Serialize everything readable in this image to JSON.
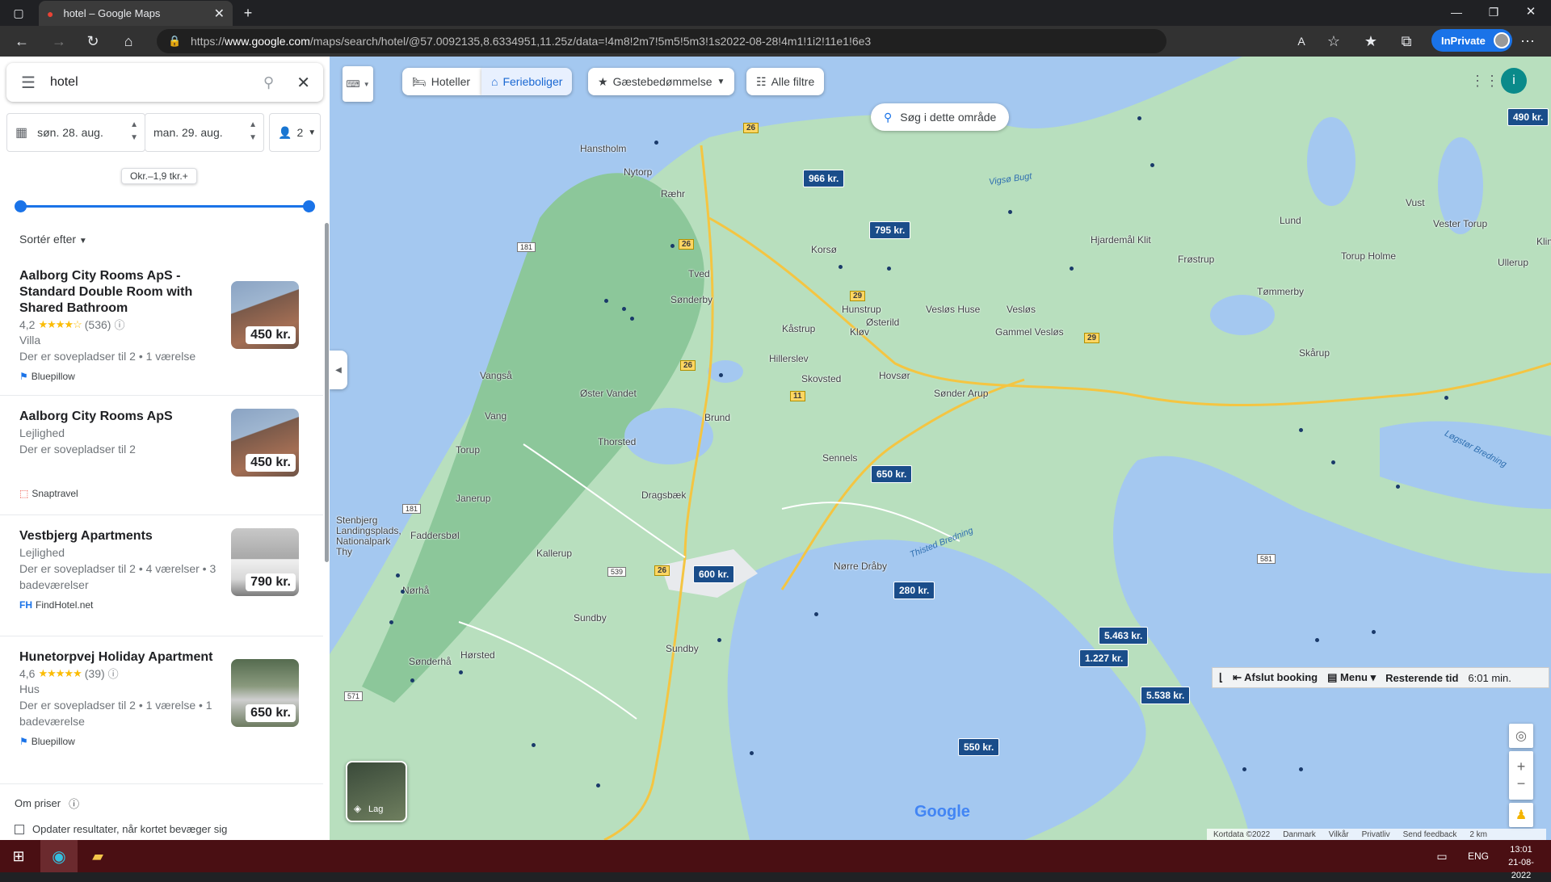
{
  "browser": {
    "tab_title": "hotel – Google Maps",
    "url_prefix": "https://",
    "url_domain": "www.google.com",
    "url_rest": "/maps/search/hotel/@57.0092135,8.6334951,11.25z/data=!4m8!2m7!5m5!5m3!1s2022-08-28!4m1!1i2!11e1!6e3",
    "inprivate_label": "InPrivate"
  },
  "search": {
    "query": "hotel"
  },
  "dates": {
    "checkin": "søn. 28. aug.",
    "checkout": "man. 29. aug.",
    "guests": "2"
  },
  "price_filter": {
    "label": "Okr.–1,9 tkr.+",
    "min_fraction": 0.0,
    "max_fraction": 1.0
  },
  "sort_label": "Sortér efter",
  "results": [
    {
      "title": "Aalborg City Rooms ApS - Standard Double Room with Shared Bathroom",
      "rating": "4,2",
      "stars": "★★★★☆",
      "reviews": "(536)",
      "type": "Villa",
      "desc": "Der er sovepladser til 2 • 1 værelse",
      "source": "Bluepillow",
      "price": "450 kr."
    },
    {
      "title": "Aalborg City Rooms ApS",
      "type": "Lejlighed",
      "desc": "Der er sovepladser til 2",
      "source": "Snaptravel",
      "price": "450 kr."
    },
    {
      "title": "Vestbjerg Apartments",
      "type": "Lejlighed",
      "desc": "Der er sovepladser til 2 • 4 værelser • 3 badeværelser",
      "source": "FindHotel.net",
      "price": "790 kr."
    },
    {
      "title": "Hunetorpvej Holiday Apartment",
      "rating": "4,6",
      "stars": "★★★★★",
      "reviews": "(39)",
      "type": "Hus",
      "desc": "Der er sovepladser til 2 • 1 værelse • 1 badeværelse",
      "source": "Bluepillow",
      "price": "650 kr."
    }
  ],
  "bottom": {
    "about_prices": "Om priser",
    "update_results": "Opdater resultater, når kortet bevæger sig"
  },
  "map": {
    "chips": {
      "hotels": "Hoteller",
      "vacation": "Ferieboliger",
      "rating": "Gæstebedømmelse",
      "all_filters": "Alle filtre"
    },
    "search_area": "Søg i dette område",
    "layers": "Lag",
    "price_markers": [
      "966 kr.",
      "795 kr.",
      "650 kr.",
      "600 kr.",
      "280 kr.",
      "5.463 kr.",
      "1.227 kr.",
      "5.538 kr.",
      "550 kr.",
      "490 kr."
    ],
    "places": [
      "Hanstholm",
      "Nytorp",
      "Ræhr",
      "Tved",
      "Sønderby",
      "Korsø",
      "Hunstrup",
      "Kåstrup",
      "Hillerslev",
      "Skovsted",
      "Kløv",
      "Østerild",
      "Vesløs Huse",
      "Vesløs",
      "Gammel Vesløs",
      "Hovsør",
      "Sønder Arup",
      "Vangså",
      "Øster Vandet",
      "Brund",
      "Thorsted",
      "Vang",
      "Torup",
      "Sennels",
      "Dragsbæk",
      "Janerup",
      "Faddersbøl",
      "Kallerup",
      "Nørhå",
      "Sundby",
      "Hørsted",
      "Sønderhå",
      "Nørre Dråby",
      "Hjardemål Klit",
      "Lund",
      "Vust",
      "Vester Torup",
      "Klim",
      "Frøstrup",
      "Torup Holme",
      "Ullerup",
      "Tømmerby",
      "Skårup",
      "Stenbjerg Landingsplads, Nationalpark Thy"
    ],
    "water": [
      "Vigsø Bugt",
      "Thisted Bredning",
      "Løgstør Bredning"
    ],
    "booking": {
      "exit": "Afslut booking",
      "menu": "Menu",
      "remaining": "Resterende tid",
      "time": "6:01 min."
    },
    "footer": [
      "Kortdata ©2022",
      "Danmark",
      "Vilkår",
      "Privatliv",
      "Send feedback",
      "2 km"
    ],
    "google_logo": "Google",
    "avatar_letter": "i"
  },
  "taskbar": {
    "lang": "ENG",
    "time": "13:01",
    "date": "21-08-2022"
  }
}
